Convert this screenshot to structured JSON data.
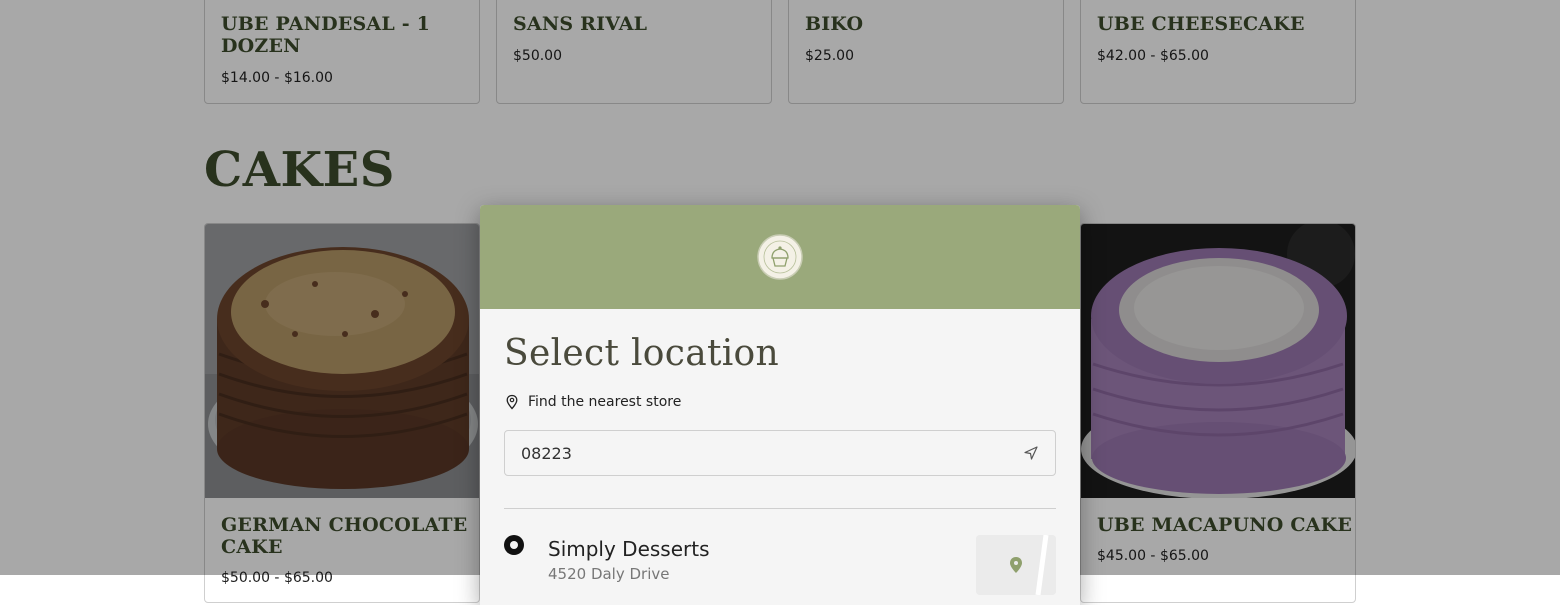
{
  "products_top": [
    {
      "name": "UBE PANDESAL - 1 DOZEN",
      "price": "$14.00 - $16.00"
    },
    {
      "name": "SANS RIVAL",
      "price": "$50.00"
    },
    {
      "name": "BIKO",
      "price": "$25.00"
    },
    {
      "name": "UBE CHEESECAKE",
      "price": "$42.00 - $65.00"
    }
  ],
  "cakes_section": {
    "title": "CAKES",
    "items": [
      {
        "name": "GERMAN CHOCOLATE CAKE",
        "price": "$50.00 - $65.00"
      },
      {
        "name": "UBE MACAPUNO CAKE",
        "price": "$45.00 - $65.00"
      }
    ]
  },
  "modal": {
    "title": "Select location",
    "nearest_label": "Find the nearest store",
    "zip_value": "08223",
    "store": {
      "name": "Simply Desserts",
      "address": "4520 Daly Drive"
    }
  },
  "icons": {
    "pin": "map-pin-icon",
    "locate": "navigation-arrow-icon",
    "logo": "cupcake-logo-icon"
  },
  "colors": {
    "brand_green": "#9aa97b",
    "heading_green": "#3e4d2c",
    "ube_purple": "#a07ab8",
    "overlay": "rgba(0,0,0,0.34)"
  }
}
